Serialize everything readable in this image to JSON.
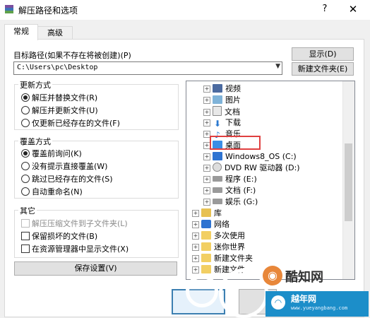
{
  "window": {
    "title": "解压路径和选项",
    "help": "?",
    "close": "✕"
  },
  "tabs": [
    {
      "label": "常规"
    },
    {
      "label": "高级"
    }
  ],
  "target": {
    "label": "目标路径(如果不存在将被创建)(P)",
    "path": "C:\\Users\\pc\\Desktop",
    "show_button": "显示(D)",
    "new_folder_button": "新建文件夹(E)"
  },
  "update_mode": {
    "title": "更新方式",
    "options": [
      "解压并替换文件(R)",
      "解压并更新文件(U)",
      "仅更新已经存在的文件(F)"
    ]
  },
  "overwrite_mode": {
    "title": "覆盖方式",
    "options": [
      "覆盖前询问(K)",
      "没有提示直接覆盖(W)",
      "跳过已经存在的文件(S)",
      "自动重命名(N)"
    ]
  },
  "misc": {
    "title": "其它",
    "options": [
      "解压压缩文件到子文件夹(L)",
      "保留损坏的文件(B)",
      "在资源管理器中显示文件(X)"
    ]
  },
  "save_button": "保存设置(V)",
  "tree": [
    {
      "label": "视频",
      "icon": "video-icon"
    },
    {
      "label": "图片",
      "icon": "image-icon"
    },
    {
      "label": "文档",
      "icon": "document-icon"
    },
    {
      "label": "下载",
      "icon": "download-icon"
    },
    {
      "label": "音乐",
      "icon": "music-icon"
    },
    {
      "label": "桌面",
      "icon": "desktop-icon"
    },
    {
      "label": "Windows8_OS (C:)",
      "icon": "windows-drive-icon"
    },
    {
      "label": "DVD RW 驱动器 (D:)",
      "icon": "dvd-icon"
    },
    {
      "label": "程序 (E:)",
      "icon": "drive-icon"
    },
    {
      "label": "文档 (F:)",
      "icon": "drive-icon"
    },
    {
      "label": "娱乐 (G:)",
      "icon": "drive-icon"
    },
    {
      "label": "库",
      "icon": "library-icon"
    },
    {
      "label": "网络",
      "icon": "network-icon"
    },
    {
      "label": "多次使用",
      "icon": "folder-icon"
    },
    {
      "label": "迷你世界",
      "icon": "folder-icon"
    },
    {
      "label": "新建文件夹",
      "icon": "folder-icon"
    },
    {
      "label": "新建文件",
      "icon": "folder-icon"
    }
  ],
  "watermark": {
    "brand": "酷知网",
    "site_name": "越年网",
    "site_url": "www.yueyangbang.com"
  },
  "colors": {
    "highlight": "#e04040",
    "accent": "#3c7fb1"
  }
}
